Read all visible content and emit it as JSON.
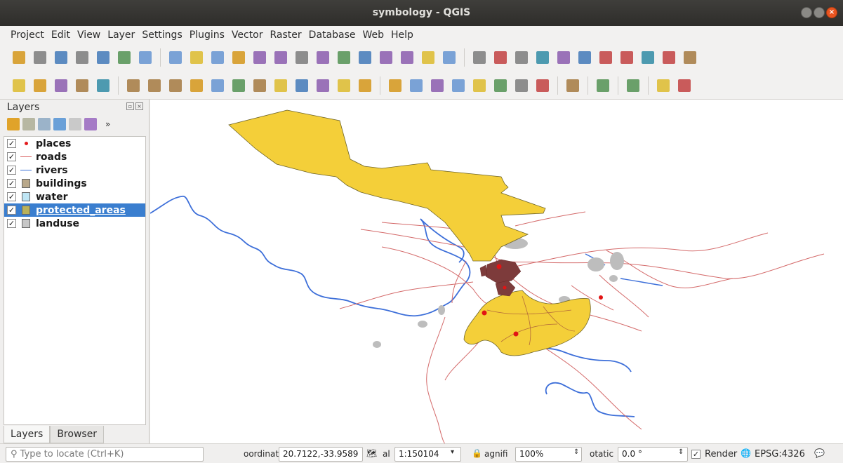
{
  "window": {
    "title": "symbology - QGIS"
  },
  "menu": [
    "Project",
    "Edit",
    "View",
    "Layer",
    "Settings",
    "Plugins",
    "Vector",
    "Raster",
    "Database",
    "Web",
    "Help"
  ],
  "toolbar1_icons": [
    "new-project-icon",
    "open-project-icon",
    "save-project-icon",
    "save-as-icon",
    "new-print-layout-icon",
    "layout-manager-icon",
    "style-manager-icon",
    "sep",
    "pan-icon",
    "pan-to-selection-icon",
    "zoom-in-icon",
    "zoom-out-icon",
    "zoom-native-icon",
    "zoom-full-icon",
    "zoom-selection-icon",
    "zoom-layer-icon",
    "zoom-last-icon",
    "zoom-next-icon",
    "new-bookmark-icon",
    "show-bookmarks-icon",
    "temporal-icon",
    "refresh-icon",
    "sep",
    "identify-icon",
    "actions-icon",
    "select-features-icon",
    "select-by-value-icon",
    "deselect-icon",
    "attribute-table-icon",
    "field-calculator-icon",
    "statistics-icon",
    "measure-icon",
    "map-tips-icon",
    "text-annotation-icon"
  ],
  "toolbar2_icons": [
    "data-source-manager-icon",
    "new-geopackage-icon",
    "digitize-icon",
    "new-spatialite-icon",
    "new-virtual-layer-icon",
    "sep",
    "current-edits-icon",
    "toggle-editing-icon",
    "save-edits-icon",
    "add-feature-icon",
    "vertex-tool-icon",
    "modify-attributes-icon",
    "delete-selected-icon",
    "cut-features-icon",
    "copy-features-icon",
    "paste-features-icon",
    "undo-icon",
    "redo-icon",
    "sep",
    "label-toolbar-icon",
    "layer-diagram-icon",
    "highlight-pinned-labels-icon",
    "pin-labels-icon",
    "show-hide-labels-icon",
    "move-label-icon",
    "rotate-label-icon",
    "change-label-icon",
    "sep",
    "metasearch-icon",
    "sep",
    "python-console-icon",
    "sep",
    "help-contents-icon",
    "sep",
    "georeferencer-icon",
    "topology-checker-icon"
  ],
  "layers_panel": {
    "title": "Layers",
    "layers": [
      {
        "label": "places",
        "symbol": "point",
        "color": "#e31a1c",
        "checked": "✓"
      },
      {
        "label": "roads",
        "symbol": "line",
        "color": "#d95f5f",
        "checked": "✓"
      },
      {
        "label": "rivers",
        "symbol": "line",
        "color": "#3a6fd8",
        "checked": "✓"
      },
      {
        "label": "buildings",
        "symbol": "fill",
        "color": "#b9a88a",
        "checked": "✓"
      },
      {
        "label": "water",
        "symbol": "fill",
        "color": "#bfe6f5",
        "checked": "✓"
      },
      {
        "label": "protected_areas",
        "symbol": "fill",
        "color": "#b9b15a",
        "checked": "✓",
        "selected": true
      },
      {
        "label": "landuse",
        "symbol": "fill",
        "color": "#c7c7c7",
        "checked": "✓"
      }
    ],
    "tabs": [
      "Layers",
      "Browser"
    ]
  },
  "map_colors": {
    "protected": "#f4cf39",
    "protected_stroke": "#6e6428",
    "roads": "#d46a6a",
    "rivers": "#3d6fd9",
    "landuse": "#bdbdbd",
    "buildings": "#7d3b3b",
    "places": "#e21414"
  },
  "status": {
    "locator_placeholder": "Type to locate (Ctrl+K)",
    "coordinate_label": "oordinat",
    "coordinate_value": "20.7122,-33.9589",
    "scale_label": "al",
    "scale_value": "1:150104",
    "magnifier_label": "agnifi",
    "magnifier_value": "100%",
    "rotation_label": "otatic",
    "rotation_value": "0.0 °",
    "render_label": "Render",
    "render_checked": "✓",
    "crs_label": "EPSG:4326"
  }
}
